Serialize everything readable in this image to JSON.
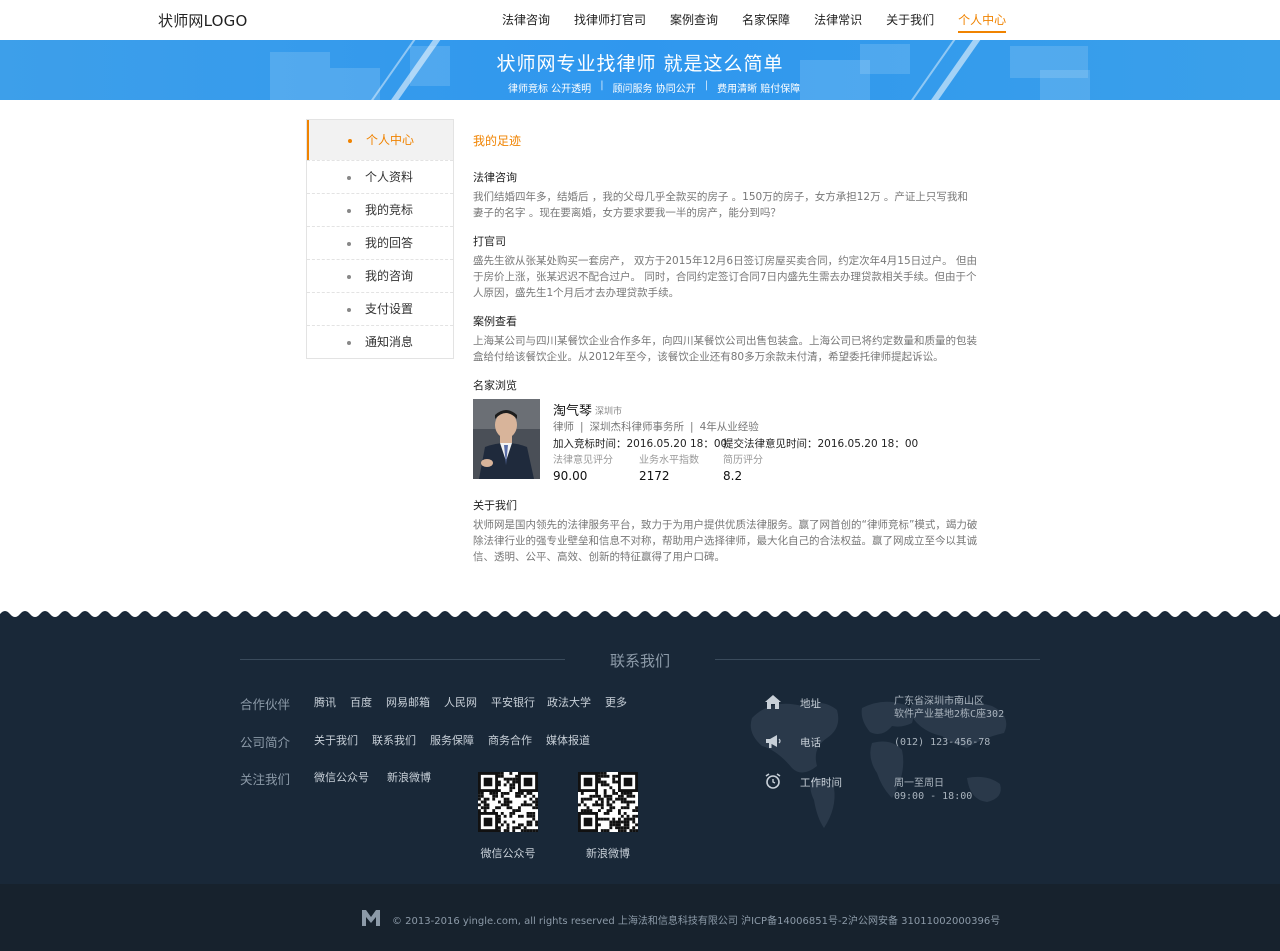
{
  "header": {
    "logo": "状师网LOGO",
    "nav": [
      {
        "label": "法律咨询",
        "active": false
      },
      {
        "label": "找律师打官司",
        "active": false
      },
      {
        "label": "案例查询",
        "active": false
      },
      {
        "label": "名家保障",
        "active": false
      },
      {
        "label": "法律常识",
        "active": false
      },
      {
        "label": "关于我们",
        "active": false
      },
      {
        "label": "个人中心",
        "active": true
      }
    ]
  },
  "banner": {
    "title": "状师网专业找律师  就是这么简单",
    "sub": [
      "律师竞标 公开透明",
      "顾问服务 协同公开",
      "费用清晰 赔付保障"
    ]
  },
  "sidebar": {
    "items": [
      {
        "label": "个人中心",
        "active": true
      },
      {
        "label": "个人资料",
        "active": false
      },
      {
        "label": "我的竞标",
        "active": false
      },
      {
        "label": "我的回答",
        "active": false
      },
      {
        "label": "我的咨询",
        "active": false
      },
      {
        "label": "支付设置",
        "active": false
      },
      {
        "label": "通知消息",
        "active": false
      }
    ]
  },
  "main": {
    "title": "我的足迹",
    "sections": [
      {
        "title": "法律咨询",
        "body": "我们结婚四年多，结婚后 ，我的父母几乎全款买的房子 。150万的房子，女方承担12万 。产证上只写我和妻子的名字 。现在要离婚，女方要求要我一半的房产，能分到吗？"
      },
      {
        "title": "打官司",
        "body": "盛先生欲从张某处购买一套房产， 双方于2015年12月6日签订房屋买卖合同，约定次年4月15日过户。 但由于房价上涨，张某迟迟不配合过户。 同时，合同约定签订合同7日内盛先生需去办理贷款相关手续。但由于个人原因，盛先生1个月后才去办理贷款手续。"
      },
      {
        "title": "案例查看",
        "body": "上海某公司与四川某餐饮企业合作多年，向四川某餐饮公司出售包装盒。上海公司已将约定数量和质量的包装盒给付给该餐饮企业。从2012年至今，该餐饮企业还有80多万余款未付清，希望委托律师提起诉讼。"
      }
    ],
    "browse_title": "名家浏览",
    "lawyer": {
      "name": "淘气琴",
      "city": "深圳市",
      "role": "律师",
      "firm": "深圳杰科律师事务所",
      "experience": "4年从业经验",
      "join_time": "加入竞标时间：2016.05.20  18：00",
      "submit_time": "提交法律意见时间：2016.05.20  18：00",
      "stats": [
        {
          "label": "法律意见评分",
          "value": "90.00"
        },
        {
          "label": "业务水平指数",
          "value": "2172"
        },
        {
          "label": "简历评分",
          "value": "8.2"
        }
      ]
    },
    "about_title": "关于我们",
    "about_body": "状师网是国内领先的法律服务平台，致力于为用户提供优质法律服务。赢了网首创的“律师竞标”模式，竭力破除法律行业的强专业壁垒和信息不对称，帮助用户选择律师，最大化自己的合法权益。赢了网成立至今以其诚信、透明、公平、高效、创新的特征赢得了用户口碑。"
  },
  "footer": {
    "title": "联系我们",
    "partners_label": "合作伙伴",
    "partners": [
      "腾讯",
      "百度",
      "网易邮箱",
      "人民网",
      "平安银行",
      "政法大学",
      "更多"
    ],
    "company_label": "公司简介",
    "company_links": [
      "关于我们",
      "联系我们",
      "服务保障",
      "商务合作",
      "媒体报道"
    ],
    "follow_label": "关注我们",
    "follow_links": [
      "微信公众号",
      "新浪微博"
    ],
    "qr_labels": [
      "微信公众号",
      "新浪微博"
    ],
    "contact": {
      "address_label": "地址",
      "address_line1": "广东省深圳市南山区",
      "address_line2": "软件产业基地2栋C座302",
      "phone_label": "电话",
      "phone": "(012) 123-456-78",
      "hours_label": "工作时间",
      "hours_line1": "周一至周日",
      "hours_line2": "09:00 - 18:00"
    },
    "copyright": "© 2013-2016 yingle.com, all rights reserved 上海法和信息科技有限公司 沪ICP备14006851号-2沪公网安备 31011002000396号"
  },
  "colors": {
    "accent": "#f08300",
    "banner": "#2f97ee",
    "footer_bg": "#192838"
  }
}
